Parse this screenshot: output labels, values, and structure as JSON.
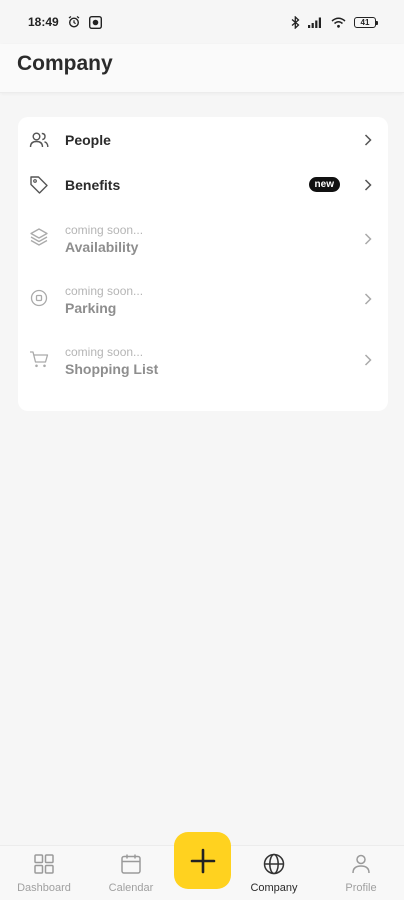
{
  "status_bar": {
    "time": "18:49",
    "battery": "41"
  },
  "header": {
    "title": "Company"
  },
  "menu": {
    "items": [
      {
        "label": "People",
        "subtitle": "",
        "icon": "people-icon",
        "enabled": true
      },
      {
        "label": "Benefits",
        "subtitle": "",
        "icon": "tag-icon",
        "enabled": true,
        "badge": "new"
      },
      {
        "label": "Availability",
        "subtitle": "coming soon...",
        "icon": "layers-icon",
        "enabled": false
      },
      {
        "label": "Parking",
        "subtitle": "coming soon...",
        "icon": "parking-icon",
        "enabled": false
      },
      {
        "label": "Shopping List",
        "subtitle": "coming soon...",
        "icon": "cart-icon",
        "enabled": false
      }
    ]
  },
  "bottom_nav": {
    "items": [
      {
        "label": "Dashboard",
        "icon": "grid-icon",
        "active": false
      },
      {
        "label": "Calendar",
        "icon": "calendar-icon",
        "active": false
      },
      {
        "label": "Company",
        "icon": "globe-icon",
        "active": true
      },
      {
        "label": "Profile",
        "icon": "user-icon",
        "active": false
      }
    ],
    "fab_icon": "plus-icon"
  },
  "colors": {
    "accent": "#ffd21f",
    "background": "#f6f6f6",
    "card": "#ffffff",
    "text_primary": "#2b2b2b",
    "text_muted": "#a0a0a0",
    "badge": "#111111"
  }
}
